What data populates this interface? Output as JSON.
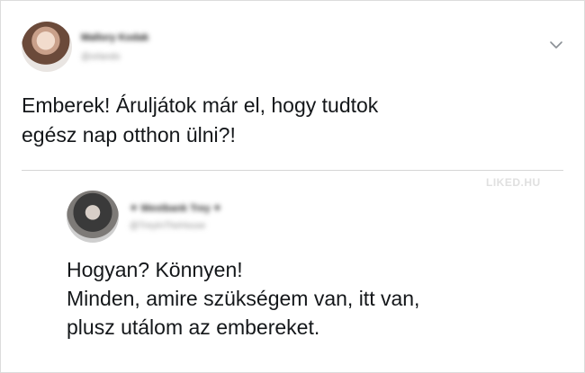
{
  "tweet": {
    "author_name": "Mallory Kodak",
    "author_handle": "@orlando",
    "text_lines": [
      "Emberek! Áruljátok már el, hogy tudtok",
      "egész nap otthon ülni?!"
    ]
  },
  "reply": {
    "author_name": "✦ Westbank Trey ✦",
    "author_handle": "@TreyInTheHouse",
    "text_lines": [
      "Hogyan? Könnyen!",
      "Minden, amire szükségem van, itt van,",
      "plusz utálom az embereket."
    ]
  },
  "watermark": "LIKED.HU",
  "icons": {
    "menu": "chevron-down-icon"
  },
  "colors": {
    "text": "#14171a",
    "divider": "#d5d5d5",
    "muted": "#8a8a8a"
  }
}
